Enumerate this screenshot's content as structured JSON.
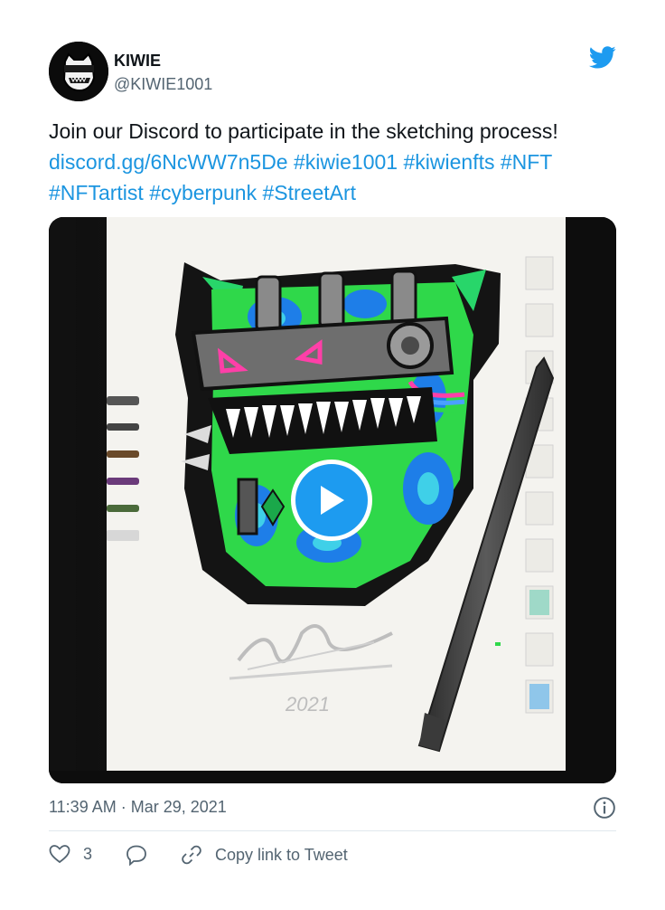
{
  "author": {
    "display_name": "KIWIE",
    "handle": "@KIWIE1001"
  },
  "tweet": {
    "text_line1": "Join our Discord to participate in the sketching process!",
    "link_discord": "discord.gg/6NcWW7n5De",
    "tags": [
      "#kiwie1001",
      "#kiwienfts",
      "#NFT",
      "#NFTartist",
      "#cyberpunk",
      "#StreetArt"
    ]
  },
  "media": {
    "type": "video",
    "play_label": "Play video",
    "signature_year": "2021"
  },
  "meta": {
    "timestamp": "11:39 AM · Mar 29, 2021"
  },
  "actions": {
    "like_count": "3",
    "copy_link_label": "Copy link to Tweet"
  },
  "icons": {
    "brand": "twitter-bird-icon",
    "info": "info-icon",
    "like": "heart-icon",
    "reply": "reply-bubble-icon",
    "copy": "link-icon"
  },
  "colors": {
    "link": "#1b95e0",
    "twitter_blue": "#1d9bf0",
    "secondary_text": "#536471",
    "primary_text": "#0f1419"
  }
}
